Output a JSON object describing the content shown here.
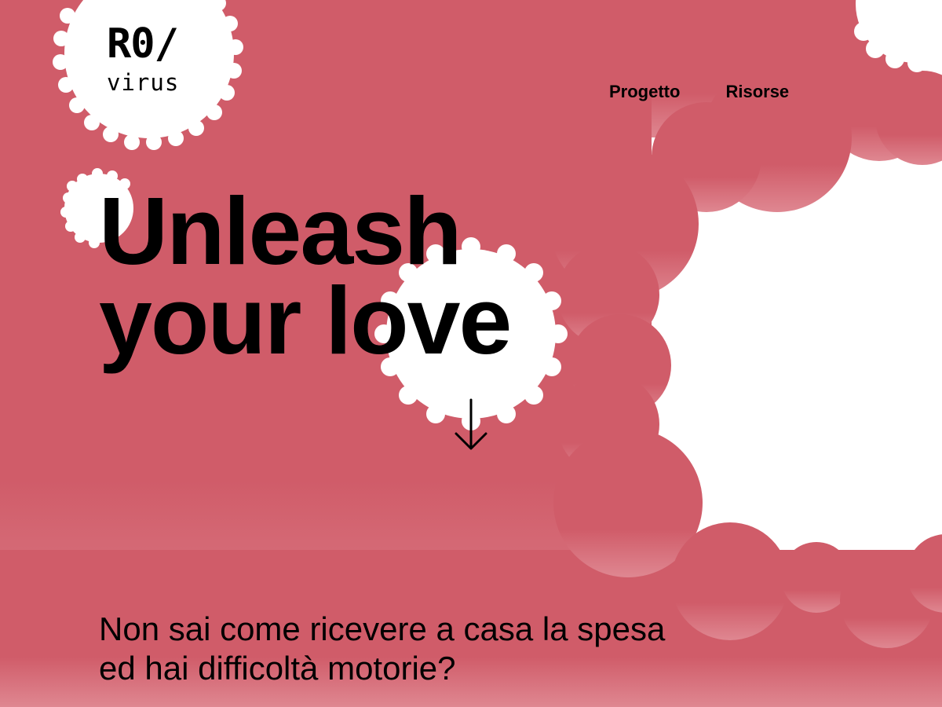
{
  "brand": {
    "logo_mark": "R0/",
    "logo_sub": "virus"
  },
  "nav": {
    "items": [
      {
        "label": "Progetto"
      },
      {
        "label": "Risorse"
      }
    ]
  },
  "hero": {
    "line1": "Unleash",
    "line2": "your love"
  },
  "intro": {
    "line1": "Non sai come ricevere a casa la spesa",
    "line2": "ed hai difficoltà motorie?"
  },
  "icons": {
    "scroll": "arrow-down-icon"
  },
  "colors": {
    "primary": "#d05c69",
    "primary_light": "#df8791",
    "text": "#000000",
    "background": "#ffffff"
  }
}
